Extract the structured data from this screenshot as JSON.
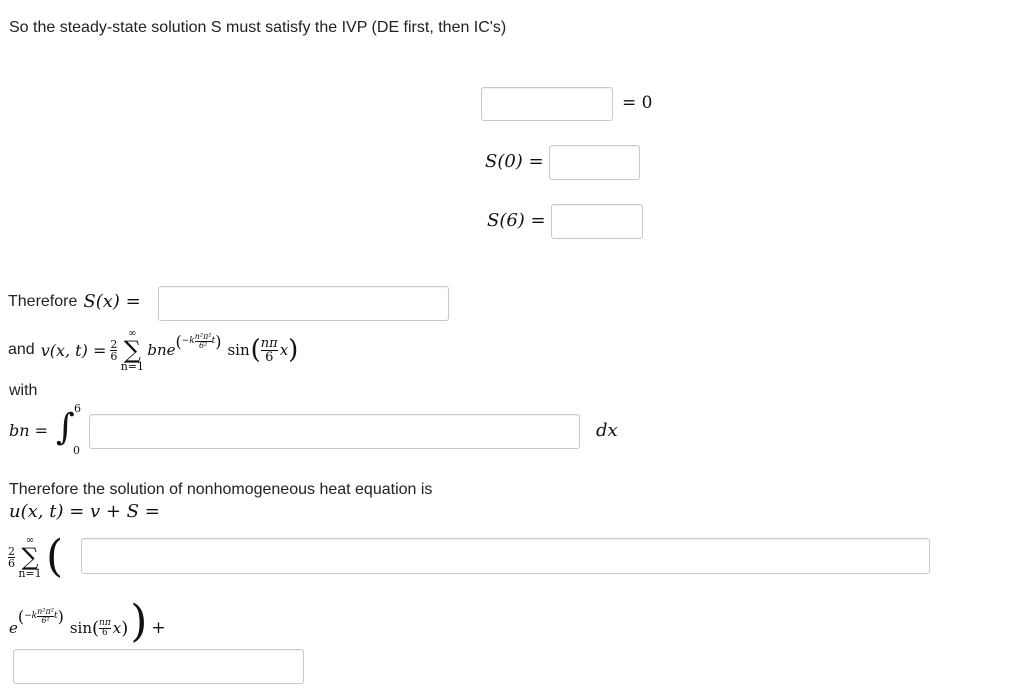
{
  "intro": "So the steady-state solution S must satisfy the IVP (DE first, then IC's)",
  "ivp": {
    "de_rhs": "= 0",
    "ic1_label": "S(0) =",
    "ic2_label": "S(6) ="
  },
  "therefore_label": "Therefore",
  "s_of_x": "S(x) =",
  "and_label": "and",
  "v_of_xt": "v(x, t) =",
  "coef_num": "2",
  "coef_den": "6",
  "sum_upper": "∞",
  "sum_lower": "n=1",
  "sigma": "∑",
  "bn_term": "bn",
  "e": "e",
  "exp_minus_k": "−k",
  "exp_num": "n²π²",
  "exp_den": "6²",
  "t": "t",
  "sin": "sin",
  "npi": "nπ",
  "six": "6",
  "x": "x",
  "with_label": "with",
  "bn_label": "bn =",
  "int_upper": "6",
  "int_lower": "0",
  "integral": "∫",
  "dx": "dx",
  "solution_text": "Therefore the solution of nonhomogeneous heat equation is",
  "u_eq": "u(x, t) = v + S =",
  "plus": "+"
}
